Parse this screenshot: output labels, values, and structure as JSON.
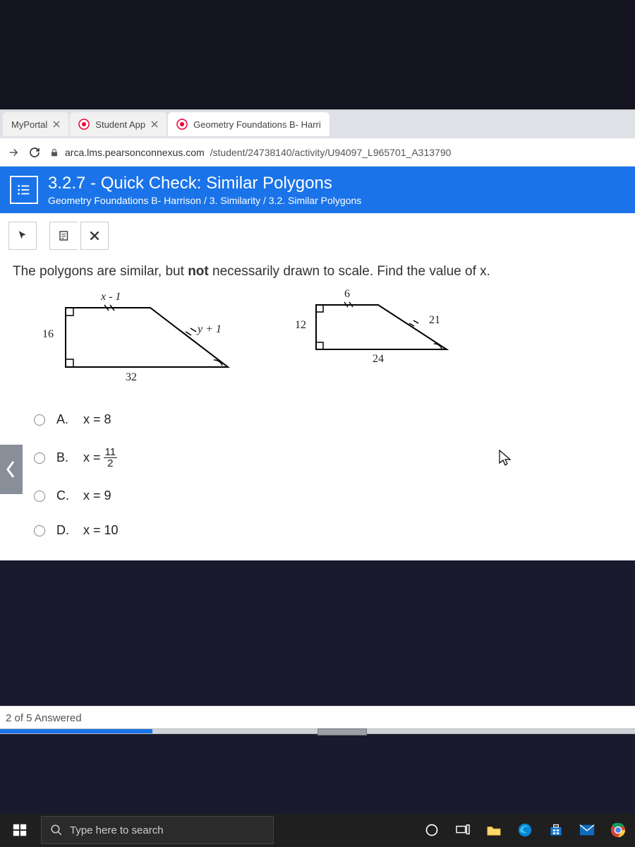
{
  "tabs": [
    {
      "label": "MyPortal"
    },
    {
      "label": "Student App"
    },
    {
      "label": "Geometry Foundations B- Harri"
    }
  ],
  "url": {
    "host": "arca.lms.pearsonconnexus.com",
    "path": "/student/24738140/activity/U94097_L965701_A313790"
  },
  "header": {
    "title": "3.2.7 - Quick Check: Similar Polygons",
    "breadcrumb": "Geometry Foundations B- Harrison / 3. Similarity / 3.2. Similar Polygons"
  },
  "question": {
    "pre": "The polygons are similar, but ",
    "bold": "not",
    "post": " necessarily drawn to scale. Find the value of x."
  },
  "fig1": {
    "top": "x - 1",
    "left": "16",
    "right": "y + 1",
    "bottom": "32"
  },
  "fig2": {
    "top": "6",
    "left": "12",
    "right": "21",
    "bottom": "24"
  },
  "choices": [
    {
      "letter": "A.",
      "text": "x = 8"
    },
    {
      "letter": "B.",
      "text_pre": "x = ",
      "frac_num": "11",
      "frac_den": "2"
    },
    {
      "letter": "C.",
      "text": "x = 9"
    },
    {
      "letter": "D.",
      "text": "x = 10"
    }
  ],
  "progress": {
    "label": "2 of 5 Answered"
  },
  "taskbar": {
    "search_placeholder": "Type here to search"
  }
}
